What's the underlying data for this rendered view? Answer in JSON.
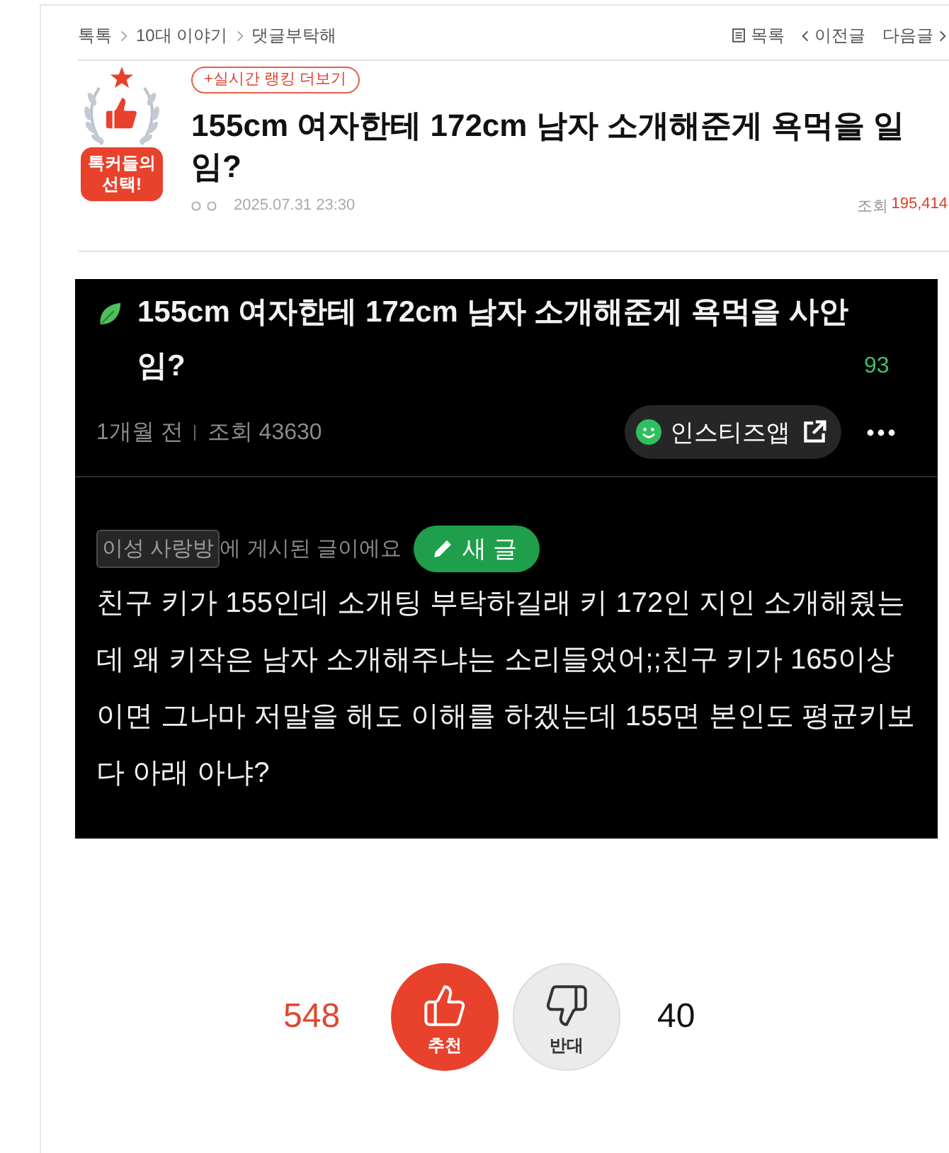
{
  "breadcrumb": [
    {
      "label": "톡톡"
    },
    {
      "label": "10대 이야기"
    },
    {
      "label": "댓글부탁해"
    }
  ],
  "nav": [
    {
      "kind": "list",
      "label": "목록"
    },
    {
      "kind": "prev",
      "label": "이전글"
    },
    {
      "kind": "next",
      "label": "다음글"
    }
  ],
  "post": {
    "badge": "톡커들의 선택!",
    "ranking_link": "+실시간 랭킹 더보기",
    "title": "155cm 여자한테 172cm 남자 소개해준게 욕먹을 일임?",
    "date": "2025.07.31 23:30",
    "views_label": "조회",
    "views": "195,414"
  },
  "embedded_screenshot": {
    "title": "155cm 여자한테 172cm 남자 소개해준게 욕먹을 사안임?",
    "comment_count": "93",
    "age": "1개월 전",
    "views": "조회 43630",
    "app_button": "인스티즈앱",
    "board": "이성 사랑방",
    "board_note": "에 게시된 글이에요",
    "new_post_button": "새 글",
    "body": "친구 키가 155인데 소개팅 부탁하길래 키 172인 지인 소개해줬는데 왜 키작은 남자 소개해주냐는 소리들었어;;친구 키가 165이상이면 그나마 저말을 해도 이해를 하겠는데 155면 본인도 평균키보다 아래 아냐?"
  },
  "votes": [
    {
      "kind": "up",
      "label": "추천",
      "count": "548"
    },
    {
      "kind": "down",
      "label": "반대",
      "count": "40"
    }
  ]
}
